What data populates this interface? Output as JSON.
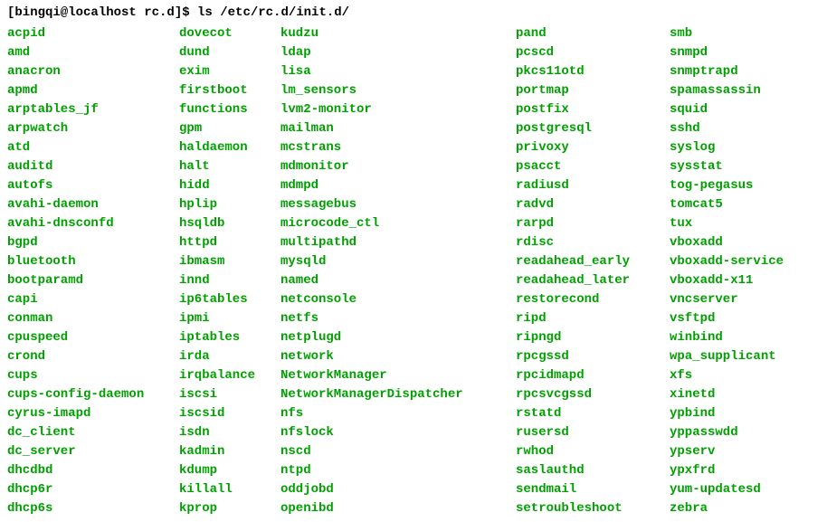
{
  "prompt": "[bingqi@localhost rc.d]$ ls /etc/rc.d/init.d/",
  "columns": [
    [
      "acpid",
      "amd",
      "anacron",
      "apmd",
      "arptables_jf",
      "arpwatch",
      "atd",
      "auditd",
      "autofs",
      "avahi-daemon",
      "avahi-dnsconfd",
      "bgpd",
      "bluetooth",
      "bootparamd",
      "capi",
      "conman",
      "cpuspeed",
      "crond",
      "cups",
      "cups-config-daemon",
      "cyrus-imapd",
      "dc_client",
      "dc_server",
      "dhcdbd",
      "dhcp6r",
      "dhcp6s"
    ],
    [
      "dovecot",
      "dund",
      "exim",
      "firstboot",
      "functions",
      "gpm",
      "haldaemon",
      "halt",
      "hidd",
      "hplip",
      "hsqldb",
      "httpd",
      "ibmasm",
      "innd",
      "ip6tables",
      "ipmi",
      "iptables",
      "irda",
      "irqbalance",
      "iscsi",
      "iscsid",
      "isdn",
      "kadmin",
      "kdump",
      "killall",
      "kprop"
    ],
    [
      "kudzu",
      "ldap",
      "lisa",
      "lm_sensors",
      "lvm2-monitor",
      "mailman",
      "mcstrans",
      "mdmonitor",
      "mdmpd",
      "messagebus",
      "microcode_ctl",
      "multipathd",
      "mysqld",
      "named",
      "netconsole",
      "netfs",
      "netplugd",
      "network",
      "NetworkManager",
      "NetworkManagerDispatcher",
      "nfs",
      "nfslock",
      "nscd",
      "ntpd",
      "oddjobd",
      "openibd"
    ],
    [
      "pand",
      "pcscd",
      "pkcs11otd",
      "portmap",
      "postfix",
      "postgresql",
      "privoxy",
      "psacct",
      "radiusd",
      "radvd",
      "rarpd",
      "rdisc",
      "readahead_early",
      "readahead_later",
      "restorecond",
      "ripd",
      "ripngd",
      "rpcgssd",
      "rpcidmapd",
      "rpcsvcgssd",
      "rstatd",
      "rusersd",
      "rwhod",
      "saslauthd",
      "sendmail",
      "setroubleshoot"
    ],
    [
      "smb",
      "snmpd",
      "snmptrapd",
      "spamassassin",
      "squid",
      "sshd",
      "syslog",
      "sysstat",
      "tog-pegasus",
      "tomcat5",
      "tux",
      "vboxadd",
      "vboxadd-service",
      "vboxadd-x11",
      "vncserver",
      "vsftpd",
      "winbind",
      "wpa_supplicant",
      "xfs",
      "xinetd",
      "ypbind",
      "yppasswdd",
      "ypserv",
      "ypxfrd",
      "yum-updatesd",
      "zebra"
    ]
  ]
}
